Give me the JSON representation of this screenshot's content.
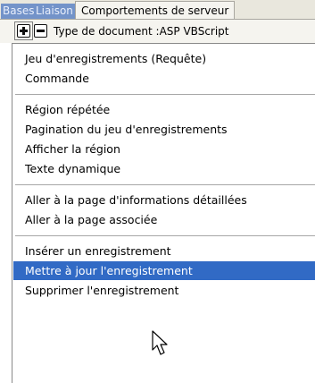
{
  "tabs": {
    "bases": "Bases",
    "liaison": "Liaison",
    "comportements": "Comportements de serveur"
  },
  "toolbar": {
    "add_icon": "plus-icon",
    "remove_icon": "minus-icon",
    "doc_type": "Type de document :ASP VBScript"
  },
  "menu": {
    "g1": [
      "Jeu d'enregistrements (Requête)",
      "Commande"
    ],
    "g2": [
      "Région répétée",
      "Pagination du jeu d'enregistrements",
      "Afficher la région",
      "Texte dynamique"
    ],
    "g3": [
      "Aller à la page d'informations détaillées",
      "Aller à la page associée"
    ],
    "g4": [
      "Insérer un enregistrement",
      "Mettre à jour l'enregistrement",
      "Supprimer l'enregistrement"
    ]
  },
  "colors": {
    "highlight": "#316ac5",
    "inactive_tab": "#7393c9",
    "panel": "#f5f4ef"
  },
  "cursor_icon": "arrow-pointer-icon"
}
